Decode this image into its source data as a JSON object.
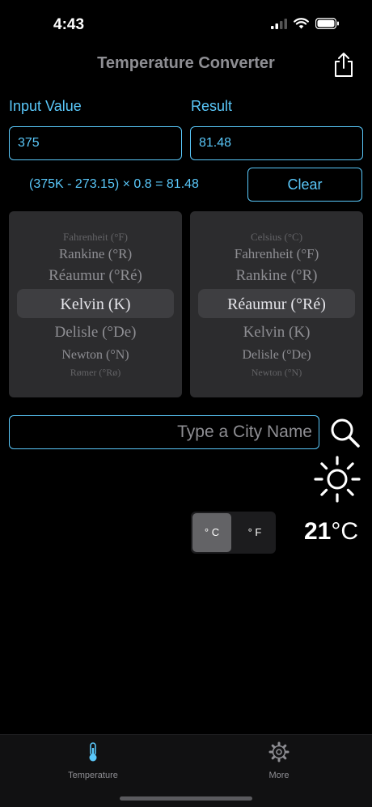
{
  "status_bar": {
    "time": "4:43"
  },
  "nav": {
    "title": "Temperature Converter"
  },
  "input": {
    "label": "Input Value",
    "value": "375"
  },
  "result": {
    "label": "Result",
    "value": "81.48"
  },
  "formula": "(375K - 273.15) × 0.8 = 81.48",
  "clear_label": "Clear",
  "from_picker": {
    "items": [
      "Fahrenheit (°F)",
      "Rankine (°R)",
      "Réaumur (°Ré)",
      "Kelvin (K)",
      "Delisle (°De)",
      "Newton (°N)",
      "Rømer (°Rø)"
    ],
    "selected": "Kelvin (K)"
  },
  "to_picker": {
    "items": [
      "Celsius (°C)",
      "Fahrenheit (°F)",
      "Rankine (°R)",
      "Réaumur (°Ré)",
      "Kelvin (K)",
      "Delisle (°De)",
      "Newton (°N)"
    ],
    "selected": "Réaumur (°Ré)"
  },
  "city_search": {
    "placeholder": "Type a City Name"
  },
  "weather": {
    "icon": "sun-icon",
    "temperature": "21",
    "unit": "°C"
  },
  "unit_toggle": {
    "celsius": "° C",
    "fahrenheit": "° F",
    "selected": "celsius"
  },
  "tabs": [
    {
      "label": "Temperature",
      "icon": "thermometer-icon",
      "active": true
    },
    {
      "label": "More",
      "icon": "gear-icon",
      "active": false
    }
  ],
  "colors": {
    "accent": "#5ac8fa",
    "background": "#000000",
    "picker_bg": "#2c2c2e",
    "muted": "#8e8e93"
  }
}
